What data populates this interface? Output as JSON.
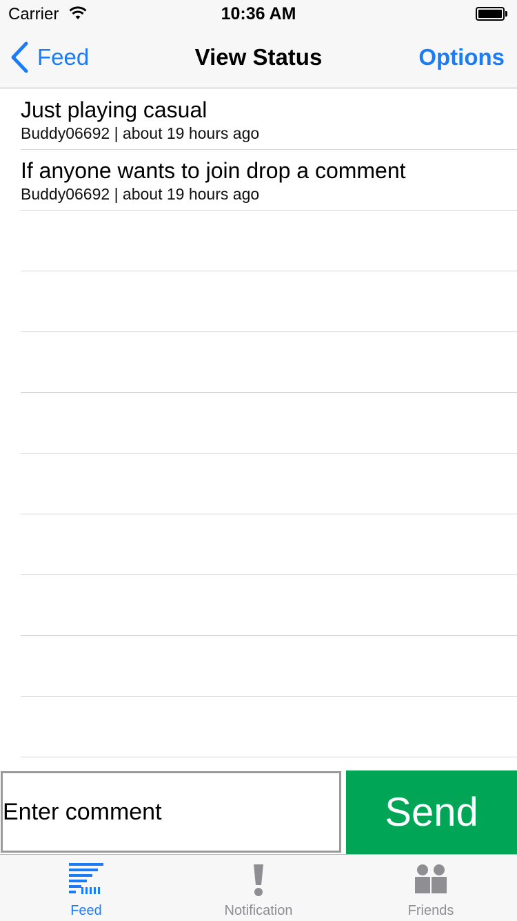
{
  "status_bar": {
    "carrier": "Carrier",
    "time": "10:36 AM"
  },
  "nav": {
    "back_label": "Feed",
    "title": "View Status",
    "options_label": "Options"
  },
  "statuses": [
    {
      "text": "Just playing casual",
      "meta": "Buddy06692 | about 19 hours ago"
    },
    {
      "text": "If anyone wants to join drop a comment",
      "meta": "Buddy06692 | about 19 hours ago"
    }
  ],
  "comment": {
    "placeholder": "Enter comment",
    "send_label": "Send"
  },
  "tabs": [
    {
      "label": "Feed",
      "icon": "feed-icon",
      "active": true
    },
    {
      "label": "Notification",
      "icon": "exclamation-icon",
      "active": false
    },
    {
      "label": "Friends",
      "icon": "friends-icon",
      "active": false
    }
  ],
  "colors": {
    "accent": "#1b7df5",
    "send": "#00a556",
    "inactive_tab": "#8e8e93"
  }
}
